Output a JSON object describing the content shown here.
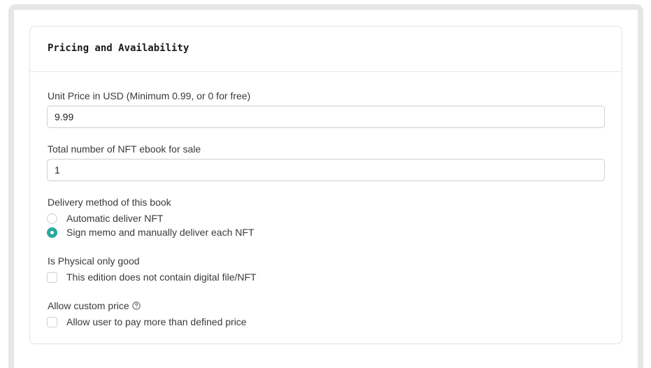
{
  "section": {
    "title": "Pricing and Availability"
  },
  "fields": {
    "unit_price": {
      "label": "Unit Price in USD (Minimum 0.99, or 0 for free)",
      "value": "9.99"
    },
    "total_number": {
      "label": "Total number of NFT ebook for sale",
      "value": "1"
    },
    "delivery_method": {
      "label": "Delivery method of this book",
      "options": [
        {
          "label": "Automatic deliver NFT",
          "selected": false
        },
        {
          "label": "Sign memo and manually deliver each NFT",
          "selected": true
        }
      ]
    },
    "physical_only": {
      "label": "Is Physical only good",
      "checkbox_label": "This edition does not contain digital file/NFT",
      "checked": false
    },
    "custom_price": {
      "label": "Allow custom price",
      "help_icon": "question-circle-icon",
      "checkbox_label": "Allow user to pay more than defined price",
      "checked": false
    }
  },
  "colors": {
    "accent": "#28a99c",
    "frame": "#e6e6e6",
    "border": "#cfcfcf"
  }
}
